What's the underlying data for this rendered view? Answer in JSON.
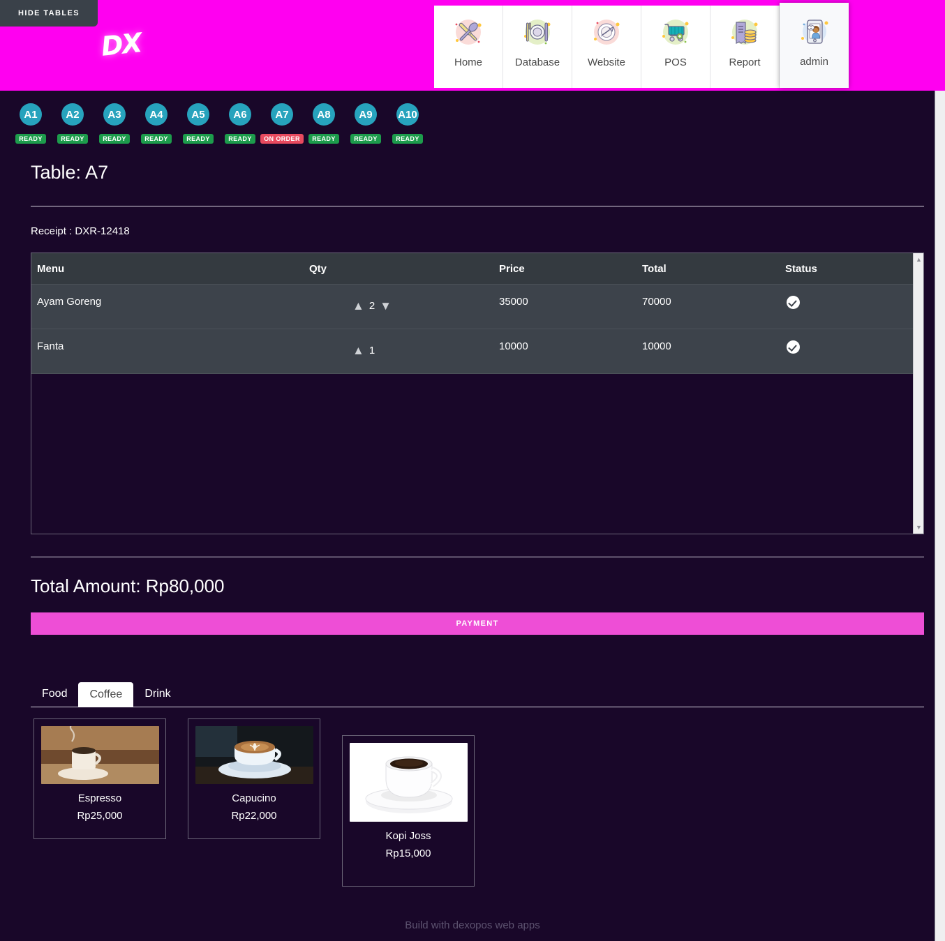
{
  "header": {
    "hide_tables_label": "HIDE TABLES",
    "brand": "DX",
    "brand_color": "#ff00f0",
    "nav": [
      {
        "label": "Home",
        "icon": "fork-knife-icon",
        "active": false
      },
      {
        "label": "Database",
        "icon": "plate-cutlery-icon",
        "active": false
      },
      {
        "label": "Website",
        "icon": "plate-web-icon",
        "active": false
      },
      {
        "label": "POS",
        "icon": "shopping-cart-icon",
        "active": false
      },
      {
        "label": "Report",
        "icon": "receipt-coins-icon",
        "active": false
      },
      {
        "label": "admin",
        "icon": "user-device-icon",
        "active": true
      }
    ]
  },
  "tables": [
    {
      "name": "A1",
      "status": "READY",
      "state": "ready"
    },
    {
      "name": "A2",
      "status": "READY",
      "state": "ready"
    },
    {
      "name": "A3",
      "status": "READY",
      "state": "ready"
    },
    {
      "name": "A4",
      "status": "READY",
      "state": "ready"
    },
    {
      "name": "A5",
      "status": "READY",
      "state": "ready"
    },
    {
      "name": "A6",
      "status": "READY",
      "state": "ready"
    },
    {
      "name": "A7",
      "status": "ON ORDER",
      "state": "onorder"
    },
    {
      "name": "A8",
      "status": "READY",
      "state": "ready"
    },
    {
      "name": "A9",
      "status": "READY",
      "state": "ready"
    },
    {
      "name": "A10",
      "status": "READY",
      "state": "ready"
    }
  ],
  "order": {
    "page_title": "Table: A7",
    "receipt_label": "Receipt : DXR-12418",
    "columns": [
      "Menu",
      "Qty",
      "Price",
      "Total",
      "Status"
    ],
    "rows": [
      {
        "menu": "Ayam Goreng",
        "qty": "2",
        "price": "35000",
        "total": "70000",
        "status_icon": "check-circle-icon",
        "can_decrease": true
      },
      {
        "menu": "Fanta",
        "qty": "1",
        "price": "10000",
        "total": "10000",
        "status_icon": "check-circle-icon",
        "can_decrease": false
      }
    ],
    "total_amount_label": "Total Amount: Rp80,000",
    "payment_label": "PAYMENT"
  },
  "categories": {
    "tabs": [
      {
        "label": "Food",
        "active": false
      },
      {
        "label": "Coffee",
        "active": true
      },
      {
        "label": "Drink",
        "active": false
      }
    ]
  },
  "products": [
    {
      "name": "Espresso",
      "price": "Rp25,000",
      "image": "espresso-photo"
    },
    {
      "name": "Capucino",
      "price": "Rp22,000",
      "image": "capucino-photo"
    },
    {
      "name": "Kopi Joss",
      "price": "Rp15,000",
      "image": "kopi-joss-photo"
    }
  ],
  "footer": {
    "text": "Build with dexopos web apps"
  },
  "colors": {
    "brand_magenta": "#ff00f0",
    "page_background": "#190729",
    "table_header": "#343a40",
    "table_row": "#3d434b",
    "chip_teal": "#27a3bd",
    "status_ready": "#1d9c4c",
    "status_onorder": "#e84a5f",
    "payment_button": "#ee4ed6"
  }
}
